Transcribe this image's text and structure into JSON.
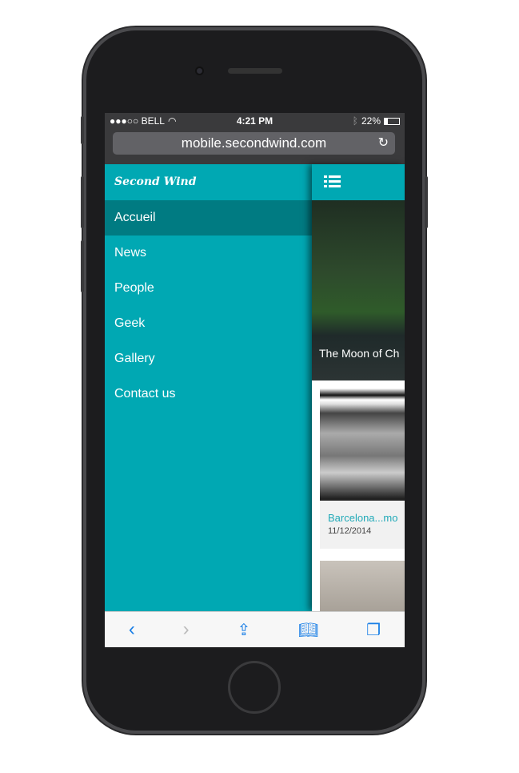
{
  "status": {
    "carrier": "●●●○○ BELL",
    "time": "4:21 PM",
    "battery": "22%",
    "battery_level": 0.22
  },
  "browser": {
    "url": "mobile.secondwind.com"
  },
  "menu": {
    "brand": "Second Wind",
    "items": [
      {
        "label": "Accueil",
        "active": true
      },
      {
        "label": "News"
      },
      {
        "label": "People"
      },
      {
        "label": "Geek"
      },
      {
        "label": "Gallery"
      },
      {
        "label": "Contact us"
      }
    ]
  },
  "content": {
    "hero_caption": "The Moon of Ch",
    "card": {
      "title": "Barcelona...mo",
      "date": "11/12/2014"
    }
  },
  "colors": {
    "menu": "#00a8b3",
    "active": "#007b82",
    "link": "#22aab8"
  }
}
